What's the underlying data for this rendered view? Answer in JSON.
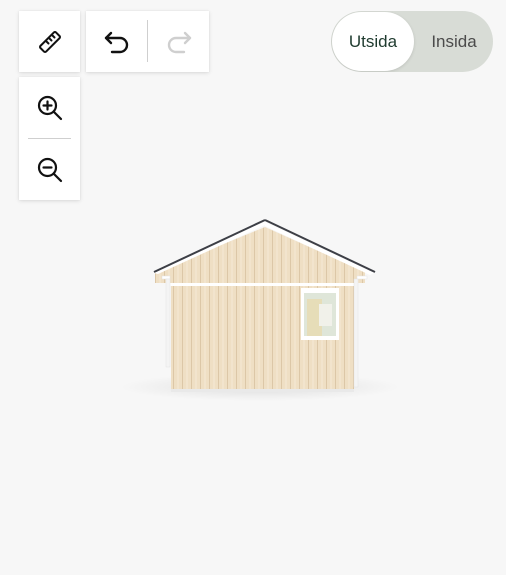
{
  "toolbar": {
    "measure": {
      "icon": "ruler-icon"
    },
    "undo": {
      "icon": "undo-icon",
      "enabled": true
    },
    "redo": {
      "icon": "redo-icon",
      "enabled": false
    },
    "zoom_in": {
      "icon": "zoom-in-icon"
    },
    "zoom_out": {
      "icon": "zoom-out-icon"
    }
  },
  "view_toggle": {
    "options": [
      {
        "label": "Utsida",
        "selected": true
      },
      {
        "label": "Insida",
        "selected": false
      }
    ],
    "active_color": "#1f3b2f",
    "track_color": "#d8dcd6"
  },
  "model": {
    "wall_color": "#efdfc4",
    "roof_edge_color": "#3d3f46",
    "window_frame_color": "#ffffff"
  }
}
